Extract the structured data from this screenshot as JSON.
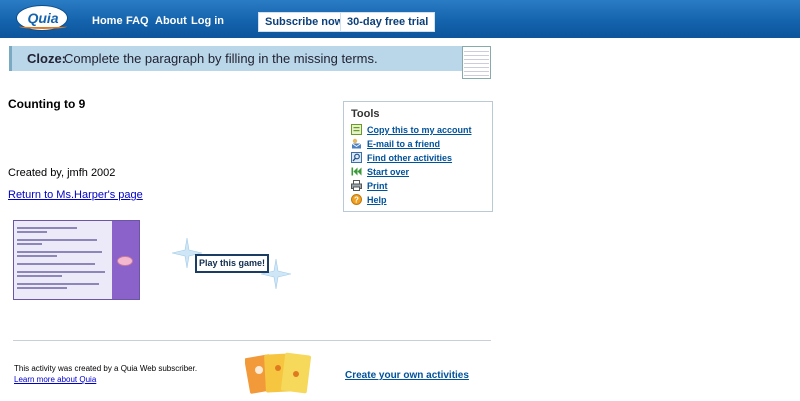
{
  "header": {
    "logo_text": "Quia",
    "nav": {
      "home": "Home",
      "faq": "FAQ",
      "about": "About",
      "login": "Log in"
    },
    "subscribe_label": "Subscribe now",
    "trial_label": "30-day free trial"
  },
  "cloze_banner": {
    "label": "Cloze:",
    "text": "Complete the paragraph by filling in the missing terms."
  },
  "activity": {
    "title": "Counting to 9",
    "created_by": "Created by, jmfh 2002",
    "return_link": "Return to Ms.Harper's page",
    "play_label": "Play this game!"
  },
  "tools": {
    "title": "Tools",
    "items": [
      {
        "label": "Copy this to my account",
        "icon": "copy-icon"
      },
      {
        "label": "E-mail to a friend",
        "icon": "email-icon"
      },
      {
        "label": "Find other activities",
        "icon": "search-icon"
      },
      {
        "label": "Start over",
        "icon": "rewind-icon"
      },
      {
        "label": "Print",
        "icon": "print-icon"
      },
      {
        "label": "Help",
        "icon": "help-icon"
      }
    ]
  },
  "footer": {
    "subscriber_text": "This activity was created by a Quia Web subscriber.",
    "learn_more": "Learn more about Quia",
    "create_link": "Create your own activities"
  },
  "colors": {
    "nav_bar": "#1463ad",
    "banner": "#b9d7e8",
    "link": "#00529b",
    "help_icon": "#f0a020"
  }
}
